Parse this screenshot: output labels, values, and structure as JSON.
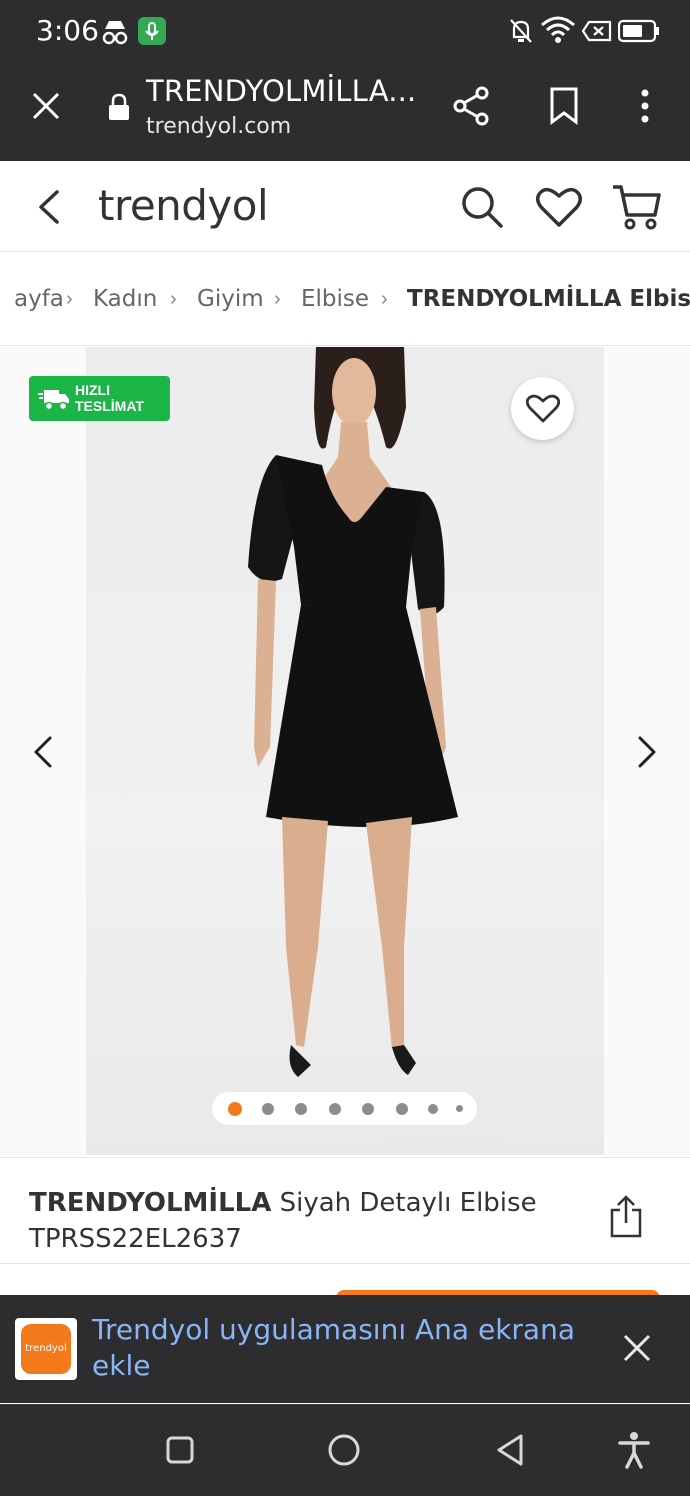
{
  "status_bar": {
    "time": "3:06"
  },
  "browser": {
    "page_title": "TRENDYOLMİLLA...",
    "url": "trendyol.com"
  },
  "header": {
    "logo": "trendyol"
  },
  "breadcrumb": {
    "items": [
      "ayfa",
      "Kadın",
      "Giyim",
      "Elbise"
    ],
    "current": "TRENDYOLMİLLA Elbise"
  },
  "product": {
    "badge_line1": "HIZLI",
    "badge_line2": "TESLİMAT",
    "brand": "TRENDYOLMİLLA",
    "name": "Siyah Detaylı Elbise",
    "code": "TPRSS22EL2637",
    "image_count": 8,
    "active_image": 1
  },
  "install_banner": {
    "icon_text": "trendyol",
    "text": "Trendyol uygulamasını Ana ekrana ekle"
  },
  "colors": {
    "brand": "#f27a1a",
    "badge": "#1bb548",
    "link": "#8ab4f8"
  }
}
